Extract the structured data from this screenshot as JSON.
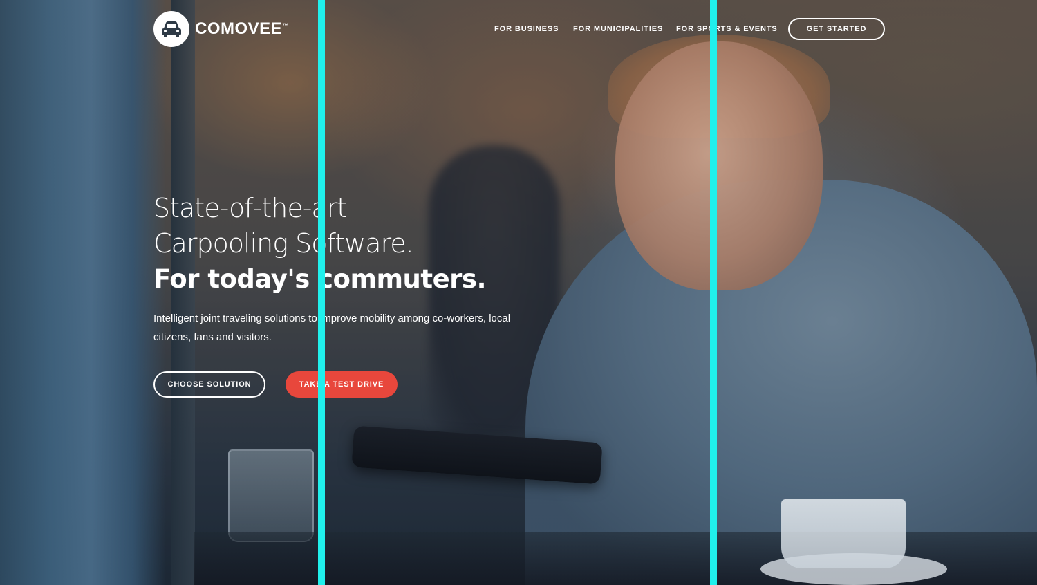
{
  "brand": {
    "name": "COMOVEE",
    "mark": "™",
    "logo_icon": "car-icon"
  },
  "nav": {
    "items": [
      {
        "label": "FOR BUSINESS"
      },
      {
        "label": "FOR MUNICIPALITIES"
      },
      {
        "label": "FOR SPORTS & EVENTS"
      }
    ],
    "cta_label": "GET STARTED"
  },
  "hero": {
    "headline_line1": "State-of-the-art",
    "headline_line2": "Carpooling Software.",
    "headline_line3": "For today's commuters.",
    "subtext": "Intelligent joint traveling solutions to improve mobility among co-workers, local citizens, fans and visitors.",
    "primary_button": "CHOOSE SOLUTION",
    "secondary_button": "TAKE A TEST DRIVE"
  },
  "colors": {
    "accent": "#e8473c",
    "overlay_lines": "#20f0ec",
    "text": "#ffffff"
  }
}
